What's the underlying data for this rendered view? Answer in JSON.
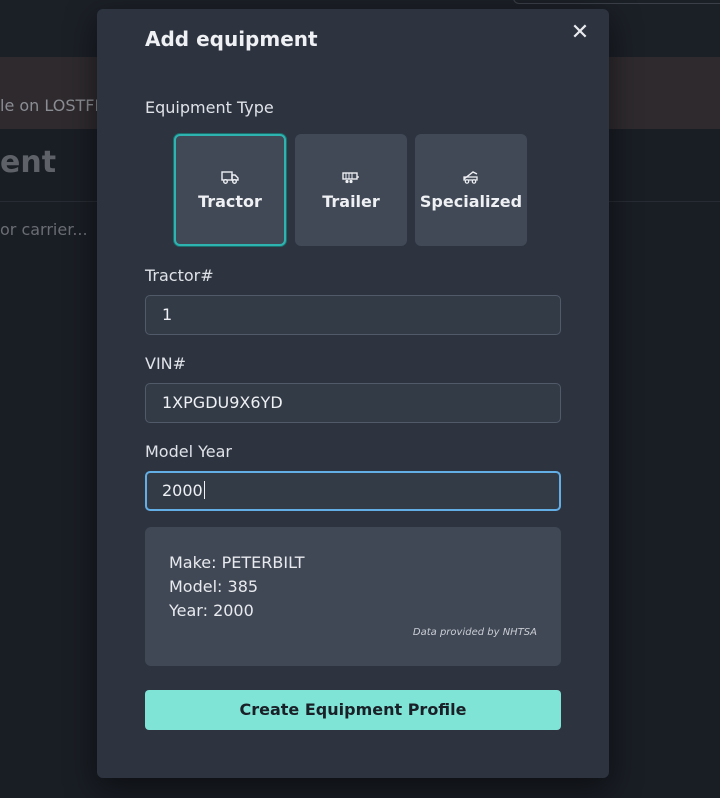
{
  "background": {
    "banner_text": "le on LOSTFR",
    "heading": "ent",
    "subtext": "or carrier..."
  },
  "modal": {
    "title": "Add equipment",
    "close_glyph": "✕",
    "equipment_type_label": "Equipment Type",
    "types": [
      {
        "label": "Tractor",
        "icon": "tractor-icon",
        "selected": true
      },
      {
        "label": "Trailer",
        "icon": "trailer-icon",
        "selected": false
      },
      {
        "label": "Specialized",
        "icon": "specialized-icon",
        "selected": false
      }
    ],
    "tractor_label": "Tractor#",
    "tractor_value": "1",
    "vin_label": "VIN#",
    "vin_value": "1XPGDU9X6YD",
    "model_year_label": "Model Year",
    "model_year_value": "2000",
    "info": {
      "make": "Make: PETERBILT",
      "model": "Model: 385",
      "year": "Year: 2000",
      "source": "Data provided by NHTSA"
    },
    "submit_label": "Create Equipment Profile"
  },
  "colors": {
    "accent": "#7fe3d5",
    "selected_border": "#2fb3b0",
    "focus_border": "#63aee4",
    "modal_bg": "#2d3440"
  }
}
